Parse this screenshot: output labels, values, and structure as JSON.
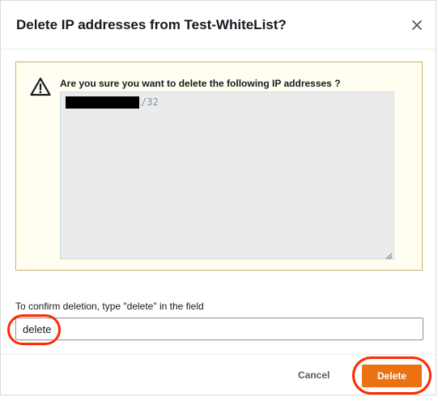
{
  "dialog": {
    "title": "Delete IP addresses from Test-WhiteList?",
    "close_icon": "close-icon"
  },
  "alert": {
    "icon": "warning-icon",
    "message": "Are you sure you want to delete the following IP addresses ?",
    "ip_list": [
      {
        "address_visible": "/32",
        "address_redacted": true
      }
    ]
  },
  "confirm": {
    "label": "To confirm deletion, type \"delete\" in the field",
    "value": "delete"
  },
  "footer": {
    "cancel_label": "Cancel",
    "delete_label": "Delete"
  },
  "colors": {
    "primary_button": "#ec7211",
    "alert_background": "#fffef1",
    "alert_border": "#c9b06b",
    "highlight_ring": "#ff2a00"
  }
}
